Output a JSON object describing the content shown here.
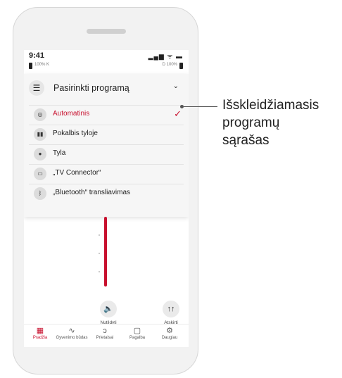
{
  "status": {
    "time": "9:41",
    "signal_icons": "▂▄▆ ᯤ ▬",
    "left_battery": "100% K",
    "right_battery": "D 100%"
  },
  "dropdown": {
    "title": "Pasirinkti programą",
    "items": [
      {
        "label": "Automatinis",
        "icon": "auto-icon",
        "selected": true
      },
      {
        "label": "Pokalbis tyloje",
        "icon": "conversation-icon",
        "selected": false
      },
      {
        "label": "Tyla",
        "icon": "quiet-icon",
        "selected": false
      },
      {
        "label": "„TV Connector“",
        "icon": "tv-icon",
        "selected": false
      },
      {
        "label": "„Bluetooth“ transliavimas",
        "icon": "bluetooth-icon",
        "selected": false
      }
    ]
  },
  "controls": {
    "mute_label": "Nutildyti",
    "split_label": "Atskirti"
  },
  "nav": [
    {
      "label": "Pradžia",
      "icon": "grid-icon",
      "active": true
    },
    {
      "label": "Gyvenimo būdas",
      "icon": "activity-icon",
      "active": false
    },
    {
      "label": "Prietaisai",
      "icon": "hearing-aid-icon",
      "active": false
    },
    {
      "label": "Pagalba",
      "icon": "chat-icon",
      "active": false
    },
    {
      "label": "Daugiau",
      "icon": "gear-icon",
      "active": false
    }
  ],
  "callout": {
    "lines": [
      "Išskleidžiamasis",
      "programų",
      "sąrašas"
    ]
  },
  "colors": {
    "accent": "#c8102e"
  }
}
